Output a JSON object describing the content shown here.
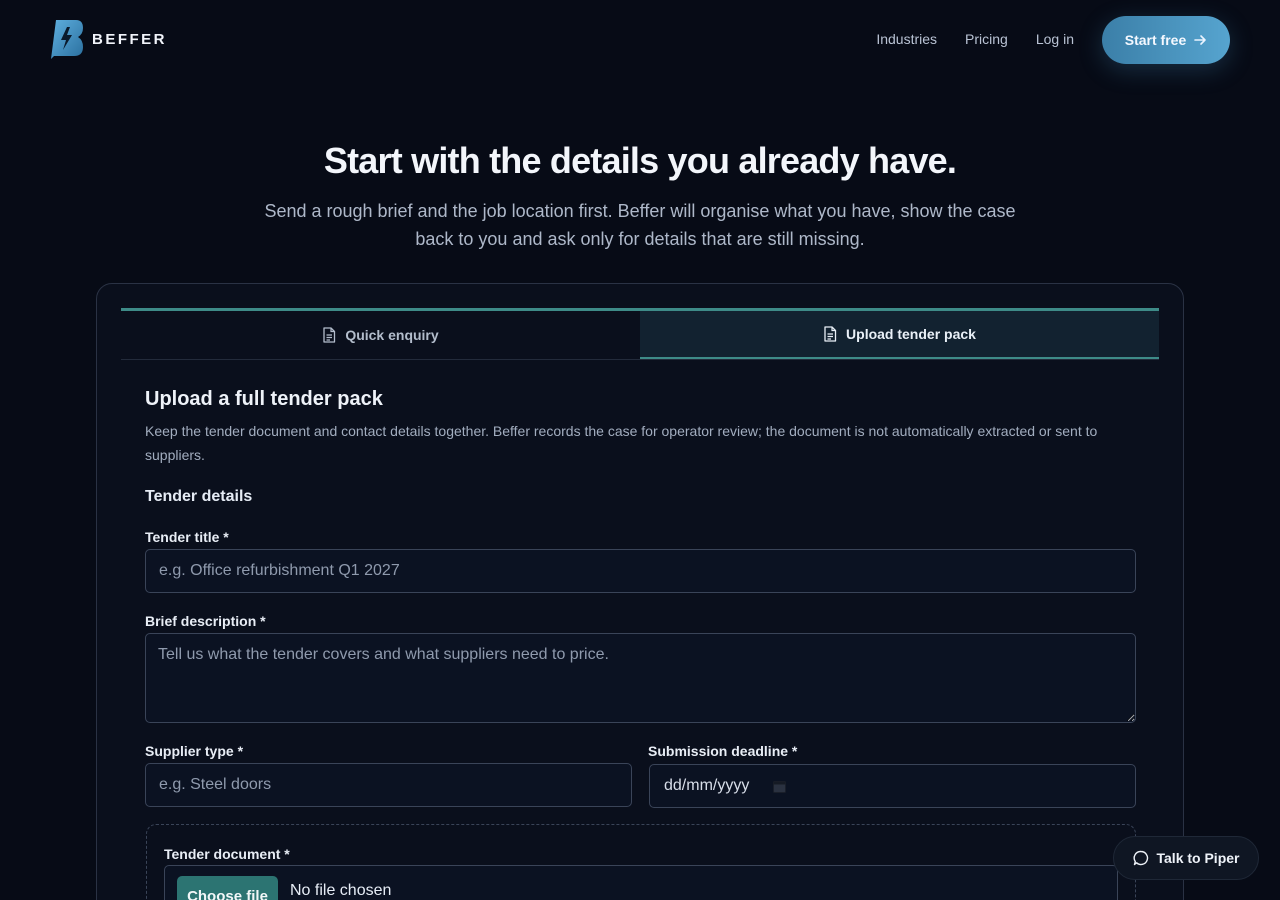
{
  "brand": {
    "name": "BEFFER",
    "accent": "#3e8b88",
    "button_gradient": [
      "#3b7fa8",
      "#56a4cf"
    ]
  },
  "nav": {
    "links": [
      "Industries",
      "Pricing",
      "Log in"
    ],
    "cta": "Start free"
  },
  "hero": {
    "title": "Start with the details you already have.",
    "subtitle": "Send a rough brief and the job location first. Beffer will organise what you have, show the case back to you and ask only for details that are still missing."
  },
  "tabs": [
    {
      "label": "Quick enquiry",
      "icon": "document-icon",
      "active": false
    },
    {
      "label": "Upload tender pack",
      "icon": "document-icon",
      "active": true
    }
  ],
  "form": {
    "title": "Upload a full tender pack",
    "description": "Keep the tender document and contact details together. Beffer records the case for operator review; the document is not automatically extracted or sent to suppliers.",
    "section_title": "Tender details",
    "tender_title": {
      "label": "Tender title *",
      "placeholder": "e.g. Office refurbishment Q1 2027",
      "value": ""
    },
    "brief_description": {
      "label": "Brief description *",
      "placeholder": "Tell us what the tender covers and what suppliers need to price.",
      "value": ""
    },
    "supplier_type": {
      "label": "Supplier type *",
      "placeholder": "e.g. Steel doors",
      "value": ""
    },
    "submission_deadline": {
      "label": "Submission deadline *",
      "placeholder": "dd/mm/yyyy"
    },
    "tender_document": {
      "label": "Tender document *",
      "button": "Choose file",
      "status": "No file chosen"
    }
  },
  "chat": {
    "label": "Talk to Piper",
    "icon": "chat-bubble-icon"
  }
}
